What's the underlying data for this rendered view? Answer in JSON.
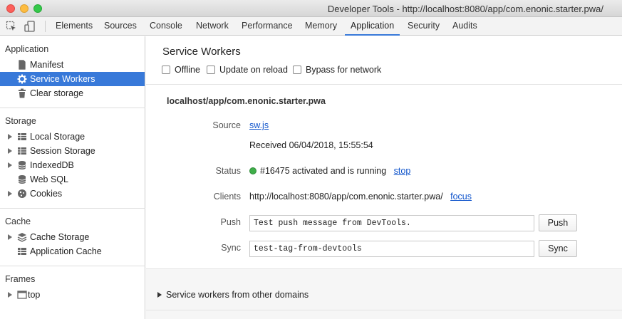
{
  "window": {
    "title": "Developer Tools - http://localhost:8080/app/com.enonic.starter.pwa/"
  },
  "toolbar": {
    "inspect_icon": "cursor-select-icon",
    "device_icon": "device-toggle-icon",
    "tabs": [
      {
        "label": "Elements"
      },
      {
        "label": "Sources"
      },
      {
        "label": "Console"
      },
      {
        "label": "Network"
      },
      {
        "label": "Performance"
      },
      {
        "label": "Memory"
      },
      {
        "label": "Application",
        "active": true
      },
      {
        "label": "Security"
      },
      {
        "label": "Audits"
      }
    ]
  },
  "sidebar": {
    "application": {
      "header": "Application",
      "items": [
        {
          "label": "Manifest",
          "icon": "document-icon"
        },
        {
          "label": "Service Workers",
          "icon": "gear-icon",
          "selected": true
        },
        {
          "label": "Clear storage",
          "icon": "trash-icon"
        }
      ]
    },
    "storage": {
      "header": "Storage",
      "items": [
        {
          "label": "Local Storage",
          "icon": "grid-icon",
          "expandable": true
        },
        {
          "label": "Session Storage",
          "icon": "grid-icon",
          "expandable": true
        },
        {
          "label": "IndexedDB",
          "icon": "database-icon",
          "expandable": true
        },
        {
          "label": "Web SQL",
          "icon": "database-icon",
          "expandable": false
        },
        {
          "label": "Cookies",
          "icon": "cookie-icon",
          "expandable": true
        }
      ]
    },
    "cache": {
      "header": "Cache",
      "items": [
        {
          "label": "Cache Storage",
          "icon": "stack-icon",
          "expandable": true
        },
        {
          "label": "Application Cache",
          "icon": "grid-icon",
          "expandable": false
        }
      ]
    },
    "frames": {
      "header": "Frames",
      "items": [
        {
          "label": "top",
          "icon": "frame-icon",
          "expandable": true
        }
      ]
    }
  },
  "main": {
    "title": "Service Workers",
    "options": [
      {
        "label": "Offline",
        "checked": false
      },
      {
        "label": "Update on reload",
        "checked": false
      },
      {
        "label": "Bypass for network",
        "checked": false
      }
    ],
    "scope": "localhost/app/com.enonic.starter.pwa",
    "source": {
      "label": "Source",
      "link": "sw.js",
      "received": "Received 06/04/2018, 15:55:54"
    },
    "status": {
      "label": "Status",
      "text": "#16475 activated and is running",
      "action": "stop",
      "color": "#3fae49"
    },
    "clients": {
      "label": "Clients",
      "url": "http://localhost:8080/app/com.enonic.starter.pwa/",
      "action": "focus"
    },
    "push": {
      "label": "Push",
      "value": "Test push message from DevTools.",
      "button": "Push"
    },
    "sync": {
      "label": "Sync",
      "value": "test-tag-from-devtools",
      "button": "Sync"
    },
    "other_domains": "Service workers from other domains"
  },
  "colors": {
    "accent": "#3879d9",
    "link": "#1155cc"
  }
}
